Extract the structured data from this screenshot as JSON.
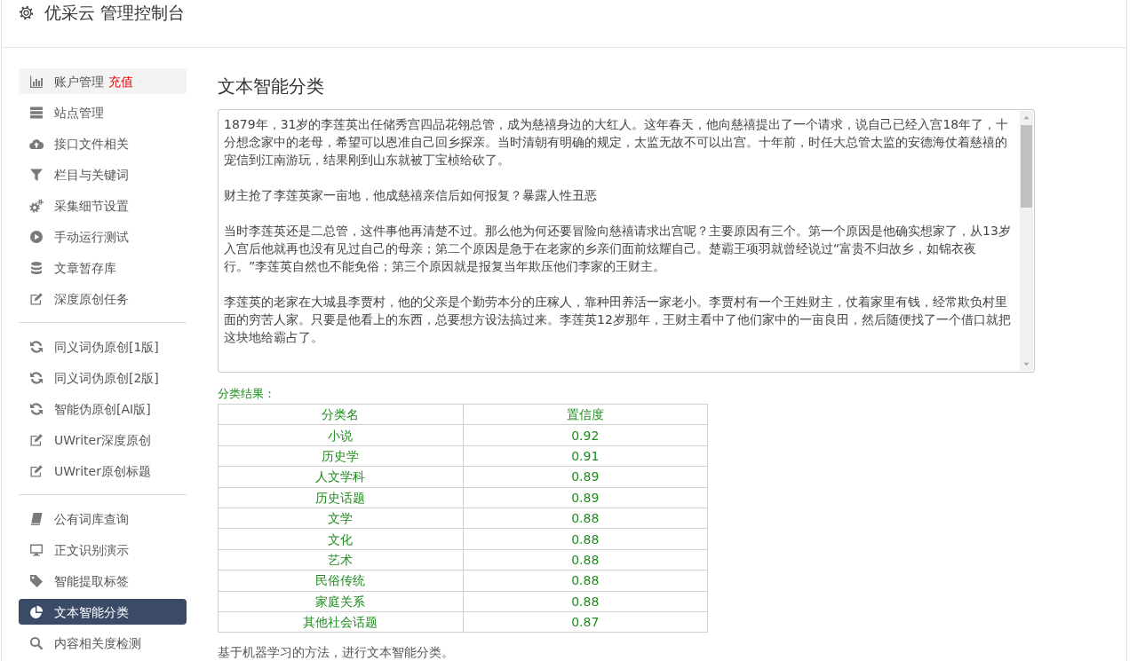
{
  "header": {
    "title": "优采云 管理控制台"
  },
  "sidebar": {
    "groups": [
      {
        "items": [
          {
            "label": "账户管理",
            "badge": "充值",
            "hovered": true,
            "selected": false
          },
          {
            "label": "站点管理",
            "hovered": false,
            "selected": false
          },
          {
            "label": "接口文件相关",
            "hovered": false,
            "selected": false
          },
          {
            "label": "栏目与关键词",
            "hovered": false,
            "selected": false
          },
          {
            "label": "采集细节设置",
            "hovered": false,
            "selected": false
          },
          {
            "label": "手动运行测试",
            "hovered": false,
            "selected": false
          },
          {
            "label": "文章暂存库",
            "hovered": false,
            "selected": false
          },
          {
            "label": "深度原创任务",
            "hovered": false,
            "selected": false
          }
        ]
      },
      {
        "items": [
          {
            "label": "同义词伪原创[1版]",
            "hovered": false,
            "selected": false
          },
          {
            "label": "同义词伪原创[2版]",
            "hovered": false,
            "selected": false
          },
          {
            "label": "智能伪原创[AI版]",
            "hovered": false,
            "selected": false
          },
          {
            "label": "UWriter深度原创",
            "hovered": false,
            "selected": false
          },
          {
            "label": "UWriter原创标题",
            "hovered": false,
            "selected": false
          }
        ]
      },
      {
        "items": [
          {
            "label": "公有词库查询",
            "hovered": false,
            "selected": false
          },
          {
            "label": "正文识别演示",
            "hovered": false,
            "selected": false
          },
          {
            "label": "智能提取标签",
            "hovered": false,
            "selected": false
          },
          {
            "label": "文本智能分类",
            "hovered": false,
            "selected": true
          },
          {
            "label": "内容相关度检测",
            "hovered": false,
            "selected": false
          }
        ]
      }
    ]
  },
  "main": {
    "title": "文本智能分类",
    "text_input": {
      "paragraphs": [
        "1879年，31岁的李莲英出任储秀宫四品花翎总管，成为慈禧身边的大红人。这年春天，他向慈禧提出了一个请求，说自己已经入宫18年了，十分想念家中的老母，希望可以恩准自己回乡探亲。当时清朝有明确的规定，太监无故不可以出宫。十年前，时任大总管太监的安德海仗着慈禧的宠信到江南游玩，结果刚到山东就被丁宝桢给砍了。",
        "财主抢了李莲英家一亩地，他成慈禧亲信后如何报复？暴露人性丑恶",
        "当时李莲英还是二总管，这件事他再清楚不过。那么他为何还要冒险向慈禧请求出宫呢？主要原因有三个。第一个原因是他确实想家了，从13岁入宫后他就再也没有见过自己的母亲；第二个原因是急于在老家的乡亲们面前炫耀自己。楚霸王项羽就曾经说过“富贵不归故乡，如锦衣夜行。”李莲英自然也不能免俗；第三个原因就是报复当年欺压他们李家的王财主。",
        "李莲英的老家在大城县李贾村，他的父亲是个勤劳本分的庄稼人，靠种田养活一家老小。李贾村有一个王姓财主，仗着家里有钱，经常欺负村里面的穷苦人家。只要是他看上的东西，总要想方设法搞过来。李莲英12岁那年，王财主看中了他们家中的一亩良田，然后随便找了一个借口就把这块地给霸占了。"
      ]
    },
    "results": {
      "label": "分类结果：",
      "columns": [
        "分类名",
        "置信度"
      ],
      "rows": [
        [
          "小说",
          "0.92"
        ],
        [
          "历史学",
          "0.91"
        ],
        [
          "人文学科",
          "0.89"
        ],
        [
          "历史话题",
          "0.89"
        ],
        [
          "文学",
          "0.88"
        ],
        [
          "文化",
          "0.88"
        ],
        [
          "艺术",
          "0.88"
        ],
        [
          "民俗传统",
          "0.88"
        ],
        [
          "家庭关系",
          "0.88"
        ],
        [
          "其他社会话题",
          "0.87"
        ]
      ]
    },
    "description": "基于机器学习的方法，进行文本智能分类。"
  }
}
